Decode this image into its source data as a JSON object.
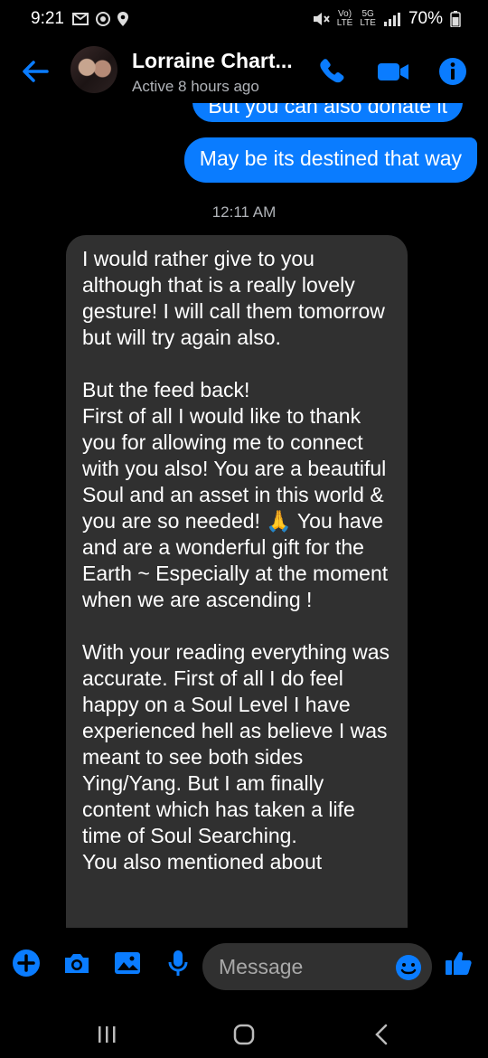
{
  "status_bar": {
    "time": "9:21",
    "left_icons": [
      "gmail-icon",
      "settings-badge-icon",
      "location-icon"
    ],
    "volte_label": "Vo)\nLTE",
    "network_label": "5G\nLTE",
    "battery": "70%"
  },
  "header": {
    "contact_name": "Lorraine Chart...",
    "contact_status": "Active 8 hours ago",
    "accent_color": "#0a7cff"
  },
  "messages": {
    "outgoing_partial": "But you can also donate it",
    "outgoing_main": "May be its destined that way",
    "timestamp": "12:11 AM",
    "incoming_text": "I would rather give to you although that is a really lovely gesture!   I will call them tomorrow but will try again also.\n\nBut the feed back!\nFirst of all I would like to thank you for allowing me to connect with you also!   You are a beautiful Soul and an asset in this world & you are so needed!  🙏  You have and are a wonderful gift for the Earth ~ Especially at the moment when we are ascending !\n\nWith your reading everything was accurate.  First of all I do feel happy on a Soul Level I have experienced hell as believe I was meant to see both sides Ying/Yang. But I am finally content which has taken a life time of Soul Searching.\nYou also mentioned about"
  },
  "composer": {
    "placeholder": "Message"
  }
}
